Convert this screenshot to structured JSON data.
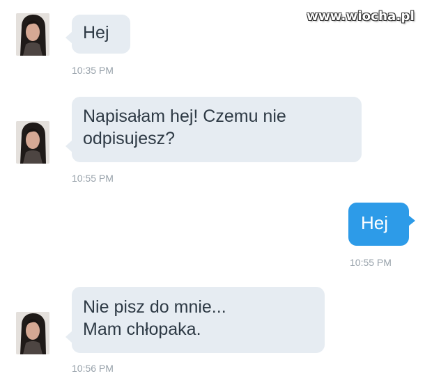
{
  "watermark": "www.wiocha.pl",
  "colors": {
    "incoming_bubble": "#e6ecf2",
    "outgoing_bubble": "#2d9be8",
    "timestamp": "#97a1aa",
    "incoming_text": "#2e3a45",
    "outgoing_text": "#ffffff"
  },
  "messages": [
    {
      "direction": "incoming",
      "lines": [
        "Hej"
      ],
      "time": "10:35 PM"
    },
    {
      "direction": "incoming",
      "lines": [
        "Napisałam hej! Czemu nie",
        "odpisujesz?"
      ],
      "time": "10:55 PM"
    },
    {
      "direction": "outgoing",
      "lines": [
        "Hej"
      ],
      "time": "10:55 PM"
    },
    {
      "direction": "incoming",
      "lines": [
        "Nie pisz do mnie...",
        "Mam chłopaka."
      ],
      "time": "10:56 PM"
    }
  ]
}
